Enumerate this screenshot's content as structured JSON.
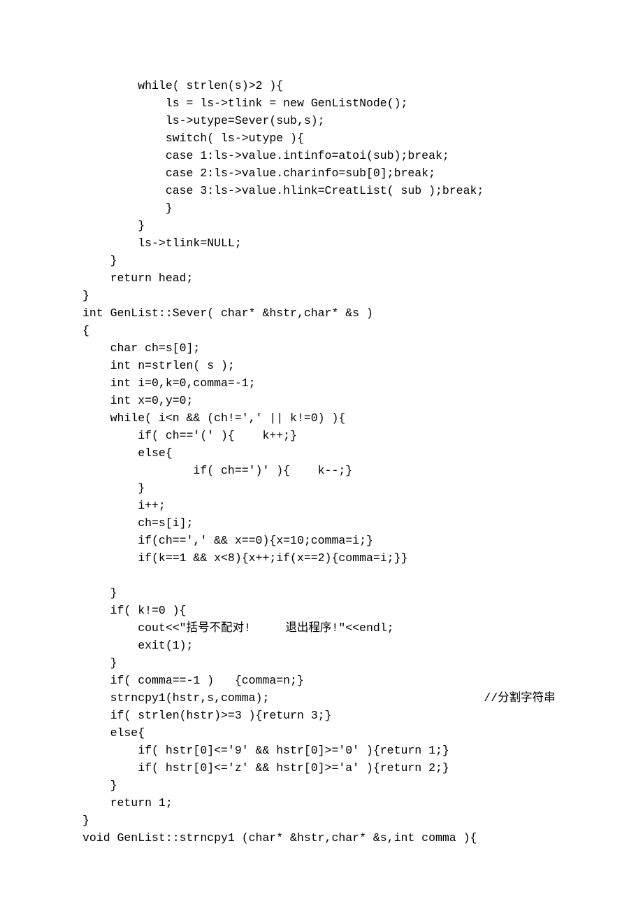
{
  "code_lines": [
    "        while( strlen(s)>2 ){",
    "            ls = ls->tlink = new GenListNode();",
    "            ls->utype=Sever(sub,s);",
    "            switch( ls->utype ){",
    "            case 1:ls->value.intinfo=atoi(sub);break;",
    "            case 2:ls->value.charinfo=sub[0];break;",
    "            case 3:ls->value.hlink=CreatList( sub );break;",
    "            }",
    "        }",
    "        ls->tlink=NULL;",
    "    }",
    "    return head;",
    "}",
    "int GenList::Sever( char* &hstr,char* &s )",
    "{",
    "    char ch=s[0];",
    "    int n=strlen( s );",
    "    int i=0,k=0,comma=-1;",
    "    int x=0,y=0;",
    "    while( i<n && (ch!=',' || k!=0) ){",
    "        if( ch=='(' ){    k++;}",
    "        else{",
    "                if( ch==')' ){    k--;}",
    "        }",
    "        i++;",
    "        ch=s[i];",
    "        if(ch==',' && x==0){x=10;comma=i;}",
    "        if(k==1 && x<8){x++;if(x==2){comma=i;}}",
    "",
    "    }",
    "    if( k!=0 ){",
    "        cout<<\"括号不配对!     退出程序!\"<<endl;",
    "        exit(1);",
    "    }",
    "    if( comma==-1 )   {comma=n;}",
    "    strncpy1(hstr,s,comma);                               //分割字符串",
    "    if( strlen(hstr)>=3 ){return 3;}",
    "    else{",
    "        if( hstr[0]<='9' && hstr[0]>='0' ){return 1;}",
    "        if( hstr[0]<='z' && hstr[0]>='a' ){return 2;}",
    "    }",
    "    return 1;",
    "}",
    "void GenList::strncpy1 (char* &hstr,char* &s,int comma ){"
  ]
}
